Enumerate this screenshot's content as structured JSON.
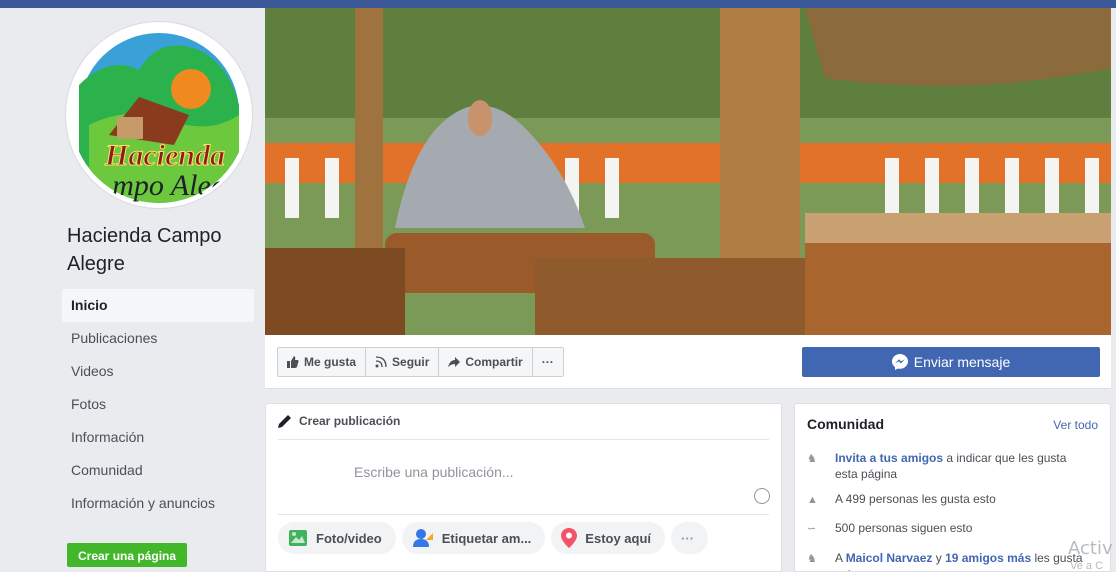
{
  "page": {
    "name": "Hacienda Campo Alegre",
    "logo_text_top": "Hacienda",
    "logo_text_bottom": "mpo Aleg"
  },
  "nav": {
    "items": [
      {
        "label": "Inicio",
        "active": true
      },
      {
        "label": "Publicaciones"
      },
      {
        "label": "Videos"
      },
      {
        "label": "Fotos"
      },
      {
        "label": "Información"
      },
      {
        "label": "Comunidad"
      },
      {
        "label": "Información y anuncios"
      }
    ],
    "create_page_label": "Crear una página"
  },
  "actions": {
    "like": "Me gusta",
    "follow": "Seguir",
    "share": "Compartir",
    "more": "···",
    "send_message": "Enviar mensaje"
  },
  "composer": {
    "title": "Crear publicación",
    "placeholder": "Escribe una publicación...",
    "chips": [
      "Foto/video",
      "Etiquetar am...",
      "Estoy aquí",
      "···"
    ]
  },
  "community": {
    "title": "Comunidad",
    "see_all": "Ver todo",
    "invite_link": "Invita a tus amigos",
    "invite_rest": " a indicar que les gusta esta página",
    "likes": "A 499 personas les gusta esto",
    "follows": "500 personas siguen esto",
    "friends_prefix": "A ",
    "friend_name": "Maicol Narvaez",
    "friends_mid": " y ",
    "friends_more": "19 amigos más",
    "friends_suffix": " les gusta esto"
  },
  "watermark": {
    "line1": "Activ",
    "line2": "Ve a C"
  },
  "colors": {
    "brand": "#3b5998",
    "button_blue": "#4267b2",
    "green": "#42b72a"
  }
}
